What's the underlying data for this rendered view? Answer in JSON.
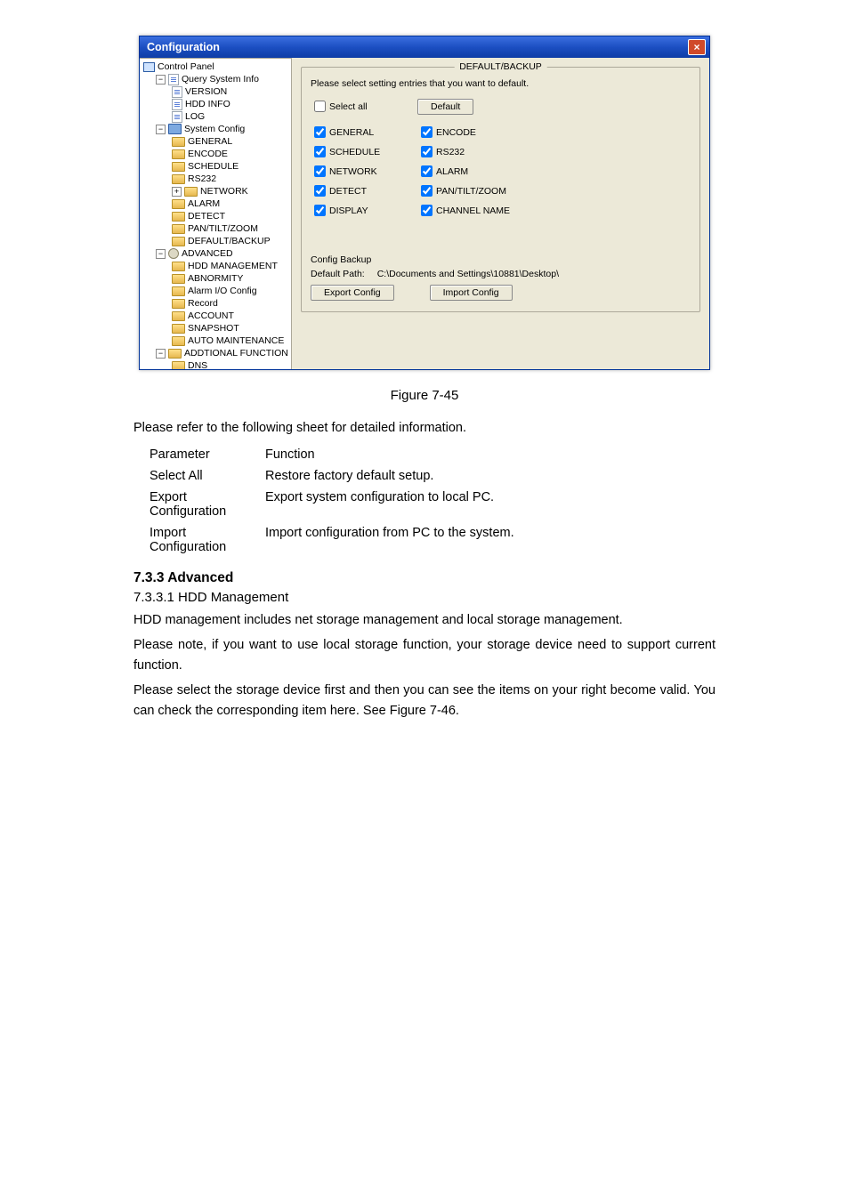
{
  "window": {
    "title": "Configuration"
  },
  "tree": {
    "root": "Control Panel",
    "g1": {
      "label": "Query System Info",
      "items": [
        "VERSION",
        "HDD INFO",
        "LOG"
      ]
    },
    "g2": {
      "label": "System Config",
      "items": [
        "GENERAL",
        "ENCODE",
        "SCHEDULE",
        "RS232",
        "NETWORK",
        "ALARM",
        "DETECT",
        "PAN/TILT/ZOOM",
        "DEFAULT/BACKUP"
      ]
    },
    "g3": {
      "label": "ADVANCED",
      "items": [
        "HDD MANAGEMENT",
        "ABNORMITY",
        "Alarm I/O Config",
        "Record",
        "ACCOUNT",
        "SNAPSHOT",
        "AUTO MAINTENANCE"
      ]
    },
    "g4": {
      "label": "ADDTIONAL FUNCTION",
      "items": [
        "DNS"
      ]
    }
  },
  "panel": {
    "group_title": "DEFAULT/BACKUP",
    "instruction": "Please select setting entries that you want to default.",
    "select_all": "Select all",
    "default_btn": "Default",
    "checks": {
      "general": "GENERAL",
      "encode": "ENCODE",
      "schedule": "SCHEDULE",
      "rs232": "RS232",
      "network": "NETWORK",
      "alarm": "ALARM",
      "detect": "DETECT",
      "ptz": "PAN/TILT/ZOOM",
      "display": "DISPLAY",
      "channel": "CHANNEL NAME"
    },
    "backup": {
      "title": "Config Backup",
      "path_label": "Default Path:",
      "path_value": "C:\\Documents and Settings\\10881\\Desktop\\",
      "export_btn": "Export Config",
      "import_btn": "Import Config"
    }
  },
  "figure_caption": "Figure 7-45",
  "intro": "Please refer to the following sheet for detailed information.",
  "table": {
    "h1": "Parameter",
    "h2": "Function",
    "r1c1": "Select All",
    "r1c2": "Restore factory default setup.",
    "r2c1": "Export Configuration",
    "r2c2": "Export system configuration to local PC.",
    "r3c1": "Import Configuration",
    "r3c2": "Import configuration from PC to the system."
  },
  "section": {
    "num_title": "7.3.3  Advanced",
    "sub_title": "7.3.3.1  HDD Management",
    "p1": "HDD management includes net storage management and local storage management.",
    "p2": "Please note, if you want to use local storage function, your storage device need to support current function.",
    "p3": "Please select the storage device first and then you can see the items on your right become valid. You can check the corresponding item here. See Figure 7-46."
  }
}
